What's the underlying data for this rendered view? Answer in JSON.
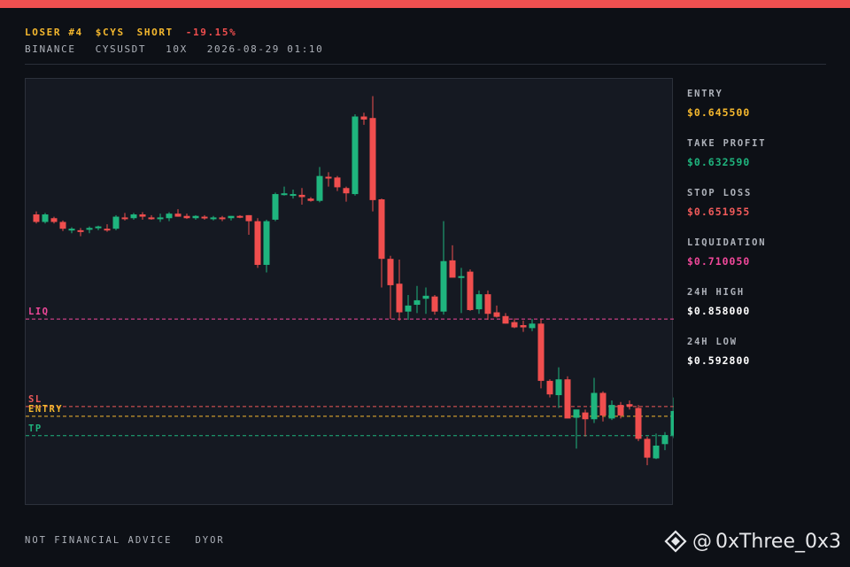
{
  "header": {
    "rank": "LOSER #4",
    "ticker": "$CYS",
    "side": "SHORT",
    "change": "-19.15%",
    "exchange": "BINANCE",
    "pair": "CYSUSDT",
    "leverage": "10X",
    "timestamp": "2026-08-29 01:10"
  },
  "stats": [
    {
      "label": "ENTRY",
      "value": "$0.645500",
      "color": "#f5b82e"
    },
    {
      "label": "TAKE PROFIT",
      "value": "$0.632590",
      "color": "#1fb57e"
    },
    {
      "label": "STOP LOSS",
      "value": "$0.651955",
      "color": "#f05a5a"
    },
    {
      "label": "LIQUIDATION",
      "value": "$0.710050",
      "color": "#f0489a"
    },
    {
      "label": "24H HIGH",
      "value": "$0.858000",
      "color": "#ffffff"
    },
    {
      "label": "24H LOW",
      "value": "$0.592800",
      "color": "#ffffff"
    }
  ],
  "footer": {
    "disclaimer": "NOT FINANCIAL ADVICE",
    "dyor": "DYOR"
  },
  "watermark": {
    "at": "@",
    "handle": "0xThree_0x3",
    "icon": "binance-logo-icon"
  },
  "colors": {
    "up": "#1fb57e",
    "down": "#f04e4e",
    "accent_bar": "#f05050"
  },
  "chart_data": {
    "type": "candlestick",
    "ylim": [
      0.586,
      0.8695
    ],
    "levels": [
      {
        "label": "LIQ",
        "value": 0.71005,
        "color": "#f0489a"
      },
      {
        "label": "SL",
        "value": 0.651955,
        "color": "#f05a5a"
      },
      {
        "label": "ENTRY",
        "value": 0.6455,
        "color": "#f5b82e"
      },
      {
        "label": "TP",
        "value": 0.63259,
        "color": "#1fb57e"
      }
    ],
    "candles": [
      [
        0.7795,
        0.7815,
        0.7735,
        0.7745
      ],
      [
        0.7745,
        0.7805,
        0.7735,
        0.7795
      ],
      [
        0.777,
        0.778,
        0.7735,
        0.7745
      ],
      [
        0.7745,
        0.7755,
        0.7685,
        0.77
      ],
      [
        0.769,
        0.771,
        0.767,
        0.77
      ],
      [
        0.769,
        0.7705,
        0.765,
        0.7685
      ],
      [
        0.7695,
        0.7715,
        0.767,
        0.7705
      ],
      [
        0.7705,
        0.772,
        0.769,
        0.7715
      ],
      [
        0.77,
        0.773,
        0.768,
        0.769
      ],
      [
        0.77,
        0.779,
        0.769,
        0.778
      ],
      [
        0.7775,
        0.7805,
        0.7755,
        0.777
      ],
      [
        0.777,
        0.7805,
        0.776,
        0.7795
      ],
      [
        0.7795,
        0.781,
        0.776,
        0.778
      ],
      [
        0.7775,
        0.779,
        0.776,
        0.777
      ],
      [
        0.777,
        0.78,
        0.7745,
        0.7775
      ],
      [
        0.777,
        0.781,
        0.775,
        0.78
      ],
      [
        0.78,
        0.783,
        0.778,
        0.778
      ],
      [
        0.7785,
        0.78,
        0.7765,
        0.777
      ],
      [
        0.777,
        0.779,
        0.776,
        0.7785
      ],
      [
        0.778,
        0.779,
        0.776,
        0.777
      ],
      [
        0.777,
        0.7785,
        0.7755,
        0.7775
      ],
      [
        0.7775,
        0.7785,
        0.775,
        0.7765
      ],
      [
        0.777,
        0.7785,
        0.7755,
        0.7785
      ],
      [
        0.7785,
        0.779,
        0.777,
        0.778
      ],
      [
        0.779,
        0.779,
        0.766,
        0.775
      ],
      [
        0.775,
        0.777,
        0.744,
        0.746
      ],
      [
        0.746,
        0.776,
        0.741,
        0.775
      ],
      [
        0.776,
        0.794,
        0.775,
        0.793
      ],
      [
        0.793,
        0.798,
        0.792,
        0.7935
      ],
      [
        0.793,
        0.796,
        0.79,
        0.793
      ],
      [
        0.7925,
        0.797,
        0.786,
        0.791
      ],
      [
        0.79,
        0.791,
        0.788,
        0.7885
      ],
      [
        0.7885,
        0.811,
        0.7875,
        0.805
      ],
      [
        0.8045,
        0.8075,
        0.798,
        0.8035
      ],
      [
        0.804,
        0.805,
        0.795,
        0.7975
      ],
      [
        0.797,
        0.798,
        0.788,
        0.7935
      ],
      [
        0.793,
        0.846,
        0.792,
        0.8445
      ],
      [
        0.8445,
        0.847,
        0.839,
        0.8425
      ],
      [
        0.8435,
        0.858,
        0.7815,
        0.789
      ],
      [
        0.7895,
        0.79,
        0.731,
        0.75
      ],
      [
        0.75,
        0.752,
        0.71,
        0.7325
      ],
      [
        0.7335,
        0.7495,
        0.709,
        0.7145
      ],
      [
        0.715,
        0.726,
        0.7095,
        0.719
      ],
      [
        0.7195,
        0.732,
        0.714,
        0.7225
      ],
      [
        0.7235,
        0.731,
        0.7135,
        0.7255
      ],
      [
        0.725,
        0.726,
        0.713,
        0.715
      ],
      [
        0.715,
        0.775,
        0.713,
        0.7485
      ],
      [
        0.749,
        0.759,
        0.738,
        0.7375
      ],
      [
        0.7375,
        0.744,
        0.714,
        0.7385
      ],
      [
        0.7415,
        0.743,
        0.7155,
        0.716
      ],
      [
        0.7165,
        0.729,
        0.7135,
        0.7265
      ],
      [
        0.7265,
        0.729,
        0.7095,
        0.7135
      ],
      [
        0.7145,
        0.719,
        0.711,
        0.7115
      ],
      [
        0.712,
        0.714,
        0.707,
        0.707
      ],
      [
        0.708,
        0.7105,
        0.704,
        0.7045
      ],
      [
        0.706,
        0.709,
        0.7015,
        0.7045
      ],
      [
        0.704,
        0.71,
        0.702,
        0.707
      ],
      [
        0.707,
        0.71,
        0.664,
        0.669
      ],
      [
        0.669,
        0.67,
        0.658,
        0.66
      ],
      [
        0.6595,
        0.678,
        0.651,
        0.67
      ],
      [
        0.67,
        0.672,
        0.646,
        0.644
      ],
      [
        0.6445,
        0.648,
        0.624,
        0.65
      ],
      [
        0.648,
        0.65,
        0.632,
        0.6435
      ],
      [
        0.6435,
        0.671,
        0.641,
        0.661
      ],
      [
        0.661,
        0.662,
        0.642,
        0.646
      ],
      [
        0.644,
        0.656,
        0.643,
        0.653
      ],
      [
        0.653,
        0.655,
        0.644,
        0.646
      ],
      [
        0.6535,
        0.656,
        0.65,
        0.652
      ],
      [
        0.651,
        0.653,
        0.629,
        0.6305
      ],
      [
        0.6305,
        0.632,
        0.613,
        0.618
      ],
      [
        0.6175,
        0.634,
        0.617,
        0.626
      ],
      [
        0.627,
        0.635,
        0.623,
        0.633
      ],
      [
        0.633,
        0.658,
        0.631,
        0.649
      ]
    ]
  }
}
